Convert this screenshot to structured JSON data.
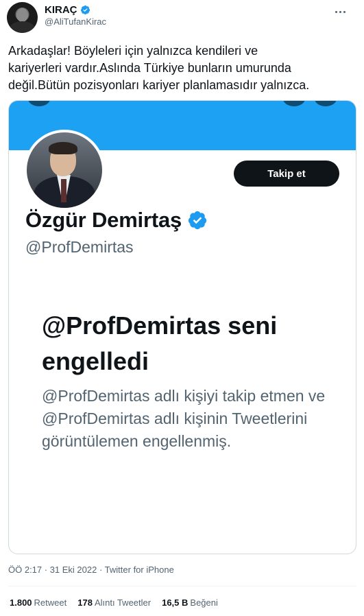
{
  "author": {
    "name": "KIRAÇ",
    "handle": "@AliTufanKirac"
  },
  "tweet": {
    "text": "Arkadaşlar! Böyleleri için yalnızca kendileri ve\nkariyerleri vardır.Aslında Türkiye bunların umurunda\ndeğil.Bütün pozisyonları kariyer planlamasıdır yalnızca."
  },
  "card": {
    "follow_label": "Takip et",
    "profile_name": "Özgür Demirtaş",
    "profile_handle": "@ProfDemirtas",
    "blocked_title": "@ProfDemirtas seni engelledi",
    "blocked_desc": "@ProfDemirtas adlı kişiyi takip etmen ve @ProfDemirtas adlı kişinin Tweetlerini görüntülemen engellenmiş."
  },
  "meta": "ÖÖ 2:17 · 31 Eki 2022 · Twitter for iPhone",
  "stats": {
    "retweets_count": "1.800",
    "retweets_label": "Retweet",
    "quotes_count": "178",
    "quotes_label": "Alıntı Tweetler",
    "likes_count": "16,5 B",
    "likes_label": "Beğeni"
  },
  "colors": {
    "verified": "#1d9bf0",
    "banner": "#1da1f2",
    "text_secondary": "#536471"
  }
}
